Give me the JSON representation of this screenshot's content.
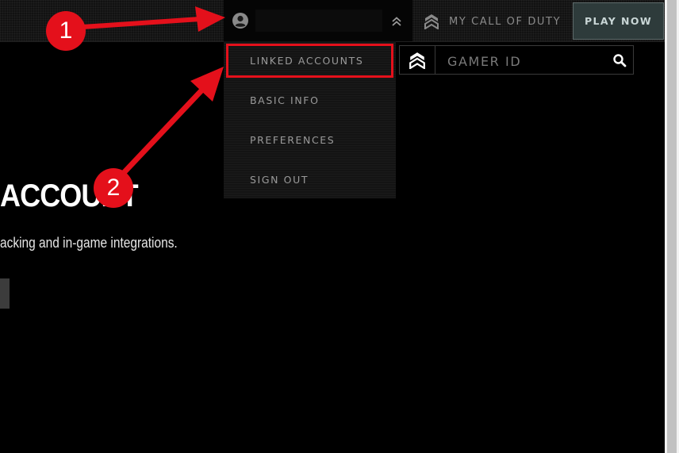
{
  "header": {
    "user_menu": {
      "icon": "user-circle-icon",
      "username": "",
      "toggle_icon": "chevron-double-up-icon"
    },
    "my_cod": {
      "icon": "cod-chevron-logo-icon",
      "label": "MY CALL OF DUTY"
    },
    "play_now_label": "PLAY NOW"
  },
  "dropdown": {
    "items": [
      {
        "label": "LINKED ACCOUNTS"
      },
      {
        "label": "BASIC INFO"
      },
      {
        "label": "PREFERENCES"
      },
      {
        "label": "SIGN OUT"
      }
    ]
  },
  "search": {
    "placeholder": "GAMER ID",
    "logo_icon": "cod-chevron-logo-icon",
    "button_icon": "search-icon"
  },
  "hero": {
    "title": "ACCOUNT",
    "subtitle": "acking and in-game integrations."
  },
  "annotations": {
    "badge_1": "1",
    "badge_2": "2",
    "color": "#e4101b"
  }
}
